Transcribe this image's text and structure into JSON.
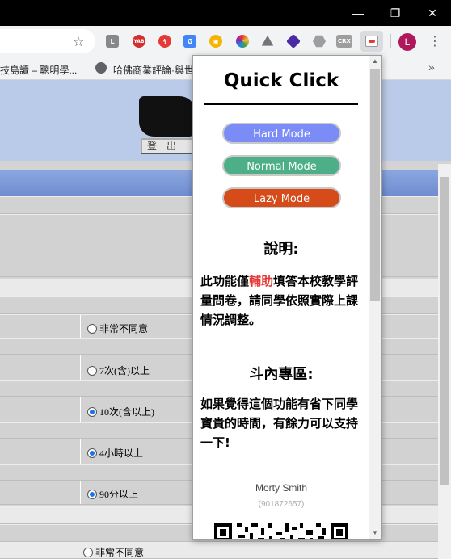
{
  "window": {
    "minimize": "—",
    "restore": "❐",
    "close": "✕"
  },
  "toolbar": {
    "extensions": [
      {
        "name": "L",
        "color": "#888888"
      },
      {
        "name": "YAB",
        "color": "#d32f2f"
      },
      {
        "name": "Adblock",
        "color": "#e53935"
      },
      {
        "name": "Translate",
        "color": "#4285f4"
      },
      {
        "name": "Owl",
        "color": "#f4b400"
      },
      {
        "name": "Color",
        "color": "#9c27b0"
      },
      {
        "name": "Drive",
        "color": "#757575"
      },
      {
        "name": "Gem",
        "color": "#4b2aa3"
      },
      {
        "name": "Hex",
        "color": "#9e9e9e"
      },
      {
        "name": "CRX",
        "color": "#9e9e9e"
      }
    ],
    "crx_label": "CRX",
    "yab_label": "YAB",
    "profile_initial": "L"
  },
  "bookmarks": {
    "item1": "技島讀 – 聰明學...",
    "item2": "哈佛商業評論·與世",
    "overflow": "»"
  },
  "page": {
    "logout_label": "登出",
    "options": [
      "非常不同意",
      "7次(含)以上",
      "10次(含以上)",
      "4小時以上",
      "90分以上",
      "非常不同意"
    ]
  },
  "popup": {
    "title": "Quick Click",
    "buttons": {
      "hard": "Hard Mode",
      "normal": "Normal Mode",
      "lazy": "Lazy Mode"
    },
    "colors": {
      "hard": "#7b8cf7",
      "normal": "#4caf87",
      "lazy": "#d54b1a",
      "highlight": "#e53935"
    },
    "explain_heading": "說明:",
    "explain_pre": "此功能僅",
    "explain_highlight": "輔助",
    "explain_post": "填答本校教學評量問卷，請同學依照實際上課情況調整。",
    "donate_heading": "斗內專區:",
    "donate_text": "如果覺得這個功能有省下同學寶貴的時間，有餘力可以支持一下!",
    "author_name": "Morty Smith",
    "author_id": "(901872657)"
  }
}
